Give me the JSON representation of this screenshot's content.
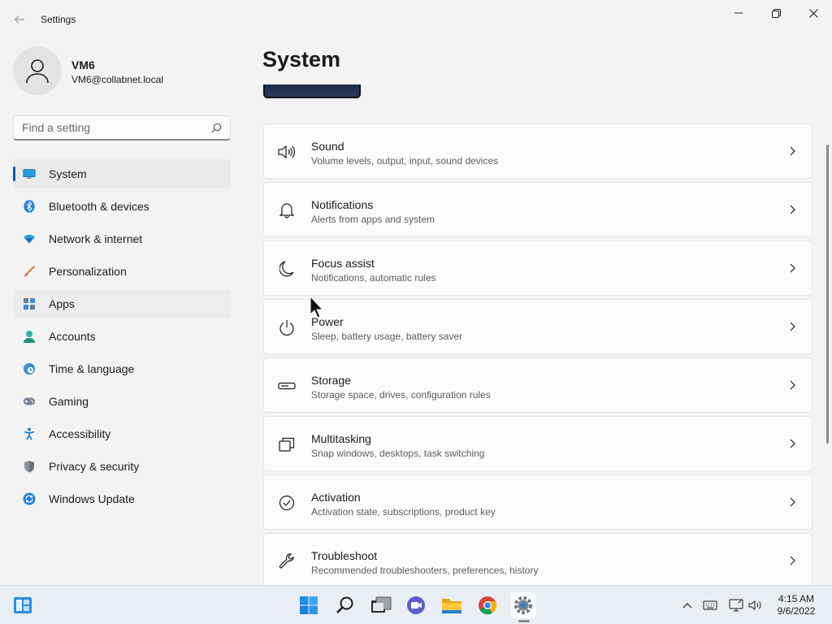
{
  "window": {
    "title": "Settings"
  },
  "user": {
    "name": "VM6",
    "email": "VM6@collabnet.local"
  },
  "search": {
    "placeholder": "Find a setting"
  },
  "nav": {
    "items": [
      {
        "label": "System"
      },
      {
        "label": "Bluetooth & devices"
      },
      {
        "label": "Network & internet"
      },
      {
        "label": "Personalization"
      },
      {
        "label": "Apps"
      },
      {
        "label": "Accounts"
      },
      {
        "label": "Time & language"
      },
      {
        "label": "Gaming"
      },
      {
        "label": "Accessibility"
      },
      {
        "label": "Privacy & security"
      },
      {
        "label": "Windows Update"
      }
    ]
  },
  "main": {
    "title": "System",
    "cards": [
      {
        "title": "Sound",
        "desc": "Volume levels, output, input, sound devices",
        "icon": "speaker-icon"
      },
      {
        "title": "Notifications",
        "desc": "Alerts from apps and system",
        "icon": "bell-icon"
      },
      {
        "title": "Focus assist",
        "desc": "Notifications, automatic rules",
        "icon": "moon-icon"
      },
      {
        "title": "Power",
        "desc": "Sleep, battery usage, battery saver",
        "icon": "power-icon"
      },
      {
        "title": "Storage",
        "desc": "Storage space, drives, configuration rules",
        "icon": "storage-icon"
      },
      {
        "title": "Multitasking",
        "desc": "Snap windows, desktops, task switching",
        "icon": "multitasking-icon"
      },
      {
        "title": "Activation",
        "desc": "Activation state, subscriptions, product key",
        "icon": "checkmark-circle-icon"
      },
      {
        "title": "Troubleshoot",
        "desc": "Recommended troubleshooters, preferences, history",
        "icon": "wrench-icon"
      }
    ]
  },
  "taskbar": {
    "time": "4:15 AM",
    "date": "9/6/2022"
  },
  "colors": {
    "accent": "#005fb8",
    "background": "#f3f3f3",
    "card": "#fbfbfb"
  }
}
